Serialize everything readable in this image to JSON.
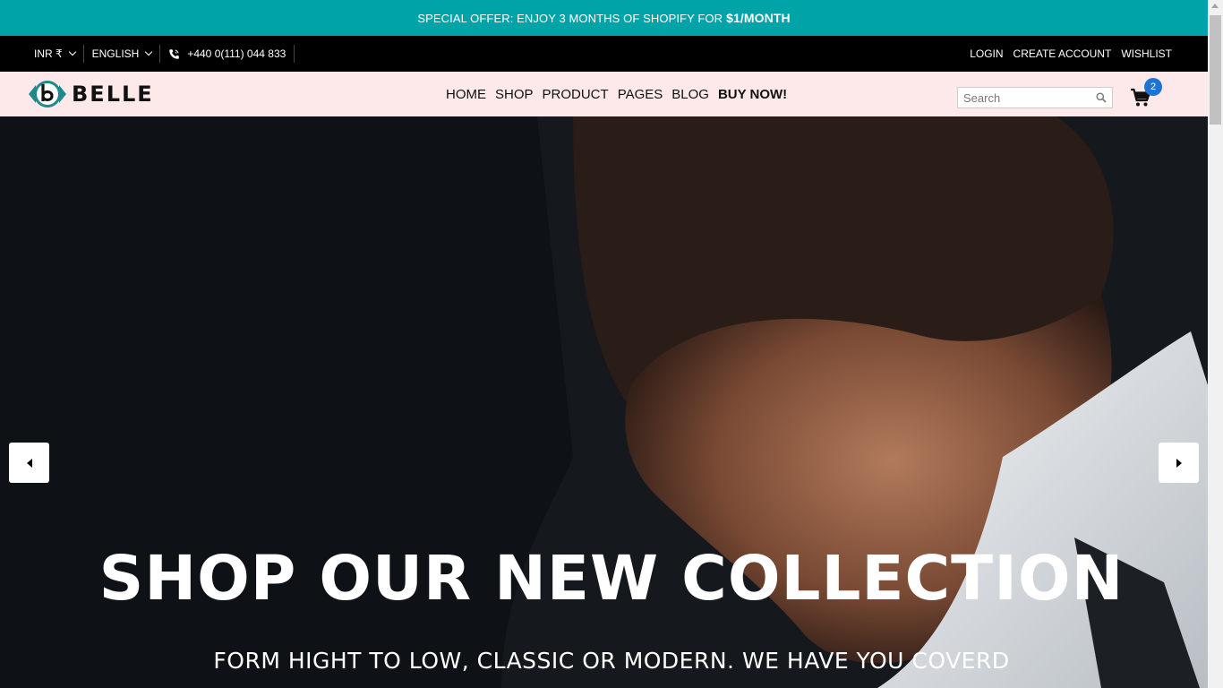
{
  "promo": {
    "text": "SPECIAL OFFER: ENJOY 3 MONTHS OF SHOPIFY FOR",
    "highlight": "$1/MONTH"
  },
  "topbar": {
    "currency": "INR ₹",
    "language": "ENGLISH",
    "phone": "+440 0(111) 044 833",
    "links": {
      "login": "LOGIN",
      "create_account": "CREATE ACCOUNT",
      "wishlist": "WISHLIST"
    }
  },
  "header": {
    "logo_text": "BELLE",
    "nav": {
      "home": "HOME",
      "shop": "SHOP",
      "product": "PRODUCT",
      "pages": "PAGES",
      "blog": "BLOG",
      "buy_now": "BUY NOW!"
    },
    "search_placeholder": "Search",
    "cart_count": "2"
  },
  "hero": {
    "title": "SHOP OUR NEW COLLECTION",
    "subtitle": "FORM HIGHT TO LOW, CLASSIC OR MODERN. WE HAVE YOU COVERD"
  },
  "colors": {
    "accent": "#00a3a8",
    "header_bg": "#fde9ea",
    "topbar_bg": "#000000",
    "badge": "#1e74d1"
  },
  "icons": [
    "phone-icon",
    "chevron-down-icon",
    "search-icon",
    "cart-icon",
    "arrow-left-icon",
    "arrow-right-icon"
  ]
}
